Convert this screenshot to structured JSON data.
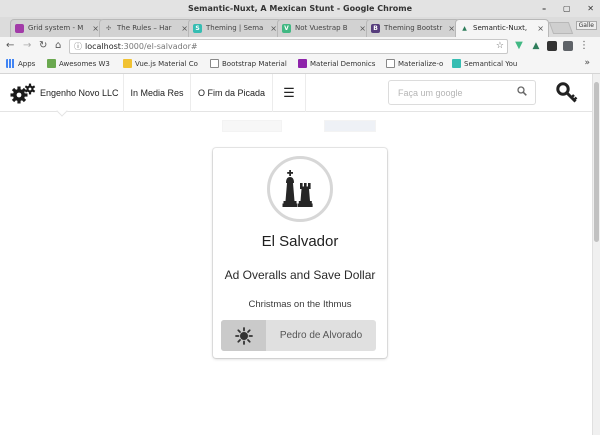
{
  "window": {
    "title": "Semantic-Nuxt, A Mexican Stunt - Google Chrome",
    "controls": [
      "–",
      "▢",
      "✕"
    ]
  },
  "tabs": [
    {
      "label": "Grid system - M",
      "favicon": "materialize-icon",
      "color": "#a23ba8",
      "glyph": "",
      "active": false
    },
    {
      "label": "The Rules – Har",
      "favicon": "puzzle-icon",
      "color": "#7a7a7a",
      "glyph": "✣",
      "active": false
    },
    {
      "label": "Theming | Sema",
      "favicon": "semantic-icon",
      "color": "#35bdb2",
      "glyph": "S",
      "active": false
    },
    {
      "label": "Not Vuestrap B",
      "favicon": "vue-icon",
      "color": "#41b883",
      "glyph": "V",
      "active": false
    },
    {
      "label": "Theming Bootstr",
      "favicon": "bootstrap-icon",
      "color": "#563d7c",
      "glyph": "B",
      "active": false
    },
    {
      "label": "Semantic-Nuxt,",
      "favicon": "nuxt-icon",
      "color": "#2e7d5b",
      "glyph": "▲",
      "active": true
    }
  ],
  "tab_close_glyph": "×",
  "profile_badge": "Galle",
  "toolbar": {
    "url_host": "localhost",
    "url_path": ":3000/el-salvador#"
  },
  "bookmarks": [
    {
      "label": "Apps",
      "color": "#4285f4"
    },
    {
      "label": "Awesomes W3",
      "color": "#6aa84f"
    },
    {
      "label": "Vue.js Material Co",
      "color": "#f1c232"
    },
    {
      "label": "Bootstrap Material",
      "color": "#ffffff"
    },
    {
      "label": "Material Demonics",
      "color": "#8e24aa"
    },
    {
      "label": "Materialize-o",
      "color": "#ffffff"
    },
    {
      "label": "Semantical You",
      "color": "#35bdb2"
    }
  ],
  "bookmarks_more": "»",
  "nav": {
    "brand": "Engenho Novo LLC",
    "item2": "In Media Res",
    "item3": "O Fim da Picada",
    "hamburger": "☰",
    "search_placeholder": "Faça um google"
  },
  "card": {
    "title": "El Salvador",
    "subtitle": "Ad Overalls and Save Dollar",
    "description": "Christmas on the Ithmus",
    "button_label": "Pedro de Alvorado"
  }
}
